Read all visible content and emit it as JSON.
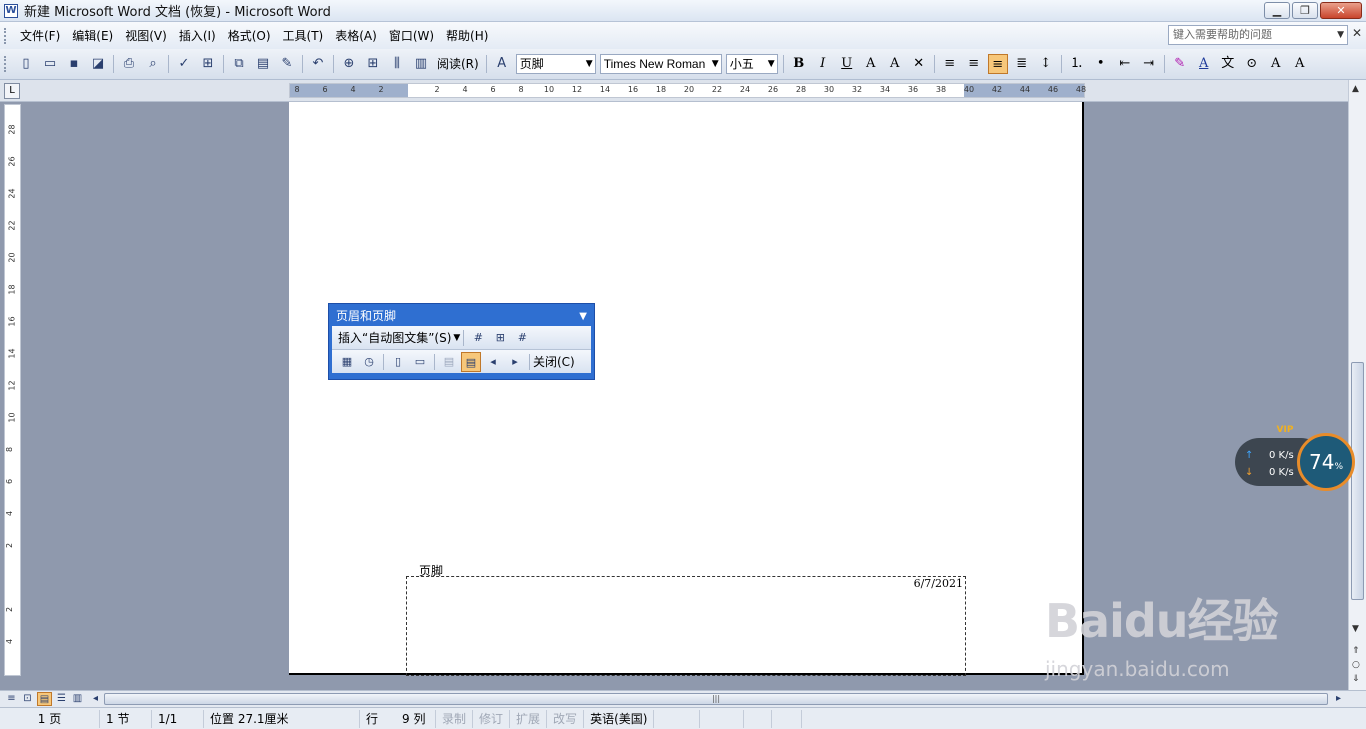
{
  "window": {
    "title": "新建 Microsoft Word 文档 (恢复) - Microsoft Word"
  },
  "menu": {
    "items": [
      "文件(F)",
      "编辑(E)",
      "视图(V)",
      "插入(I)",
      "格式(O)",
      "工具(T)",
      "表格(A)",
      "窗口(W)",
      "帮助(H)"
    ],
    "help_placeholder": "键入需要帮助的问题"
  },
  "toolbar": {
    "read_label": "阅读(R)",
    "style_value": "页脚",
    "font_value": "Times New Roman",
    "size_value": "小五"
  },
  "ruler": {
    "h_ticks": [
      "8",
      "6",
      "4",
      "2",
      "",
      "2",
      "4",
      "6",
      "8",
      "10",
      "12",
      "14",
      "16",
      "18",
      "20",
      "22",
      "24",
      "26",
      "28",
      "30",
      "32",
      "34",
      "36",
      "38",
      "40",
      "42",
      "44",
      "46",
      "48"
    ],
    "v_ticks": [
      "28",
      "26",
      "24",
      "22",
      "20",
      "18",
      "16",
      "14",
      "12",
      "10",
      "8",
      "6",
      "4",
      "2",
      "",
      "2",
      "4"
    ]
  },
  "header_footer_toolbar": {
    "title": "页眉和页脚",
    "insert_autotext": "插入“自动图文集”(S)",
    "close_label": "关闭(C)"
  },
  "document": {
    "footer_label": "页脚",
    "footer_date": "6/7/2021"
  },
  "net_widget": {
    "upload": "0 K/s",
    "download": "0 K/s",
    "percent": "74",
    "percent_sign": "%",
    "vip": "VIP"
  },
  "status": {
    "page": "1 页",
    "section": "1 节",
    "page_of": "1/1",
    "position": "位置 27.1厘米",
    "line": "行",
    "column": "9 列",
    "record": "录制",
    "revise": "修订",
    "extend": "扩展",
    "overwrite": "改写",
    "language": "英语(美国)"
  },
  "watermark": {
    "logo": "Baidu经验",
    "url": "jingyan.baidu.com"
  }
}
